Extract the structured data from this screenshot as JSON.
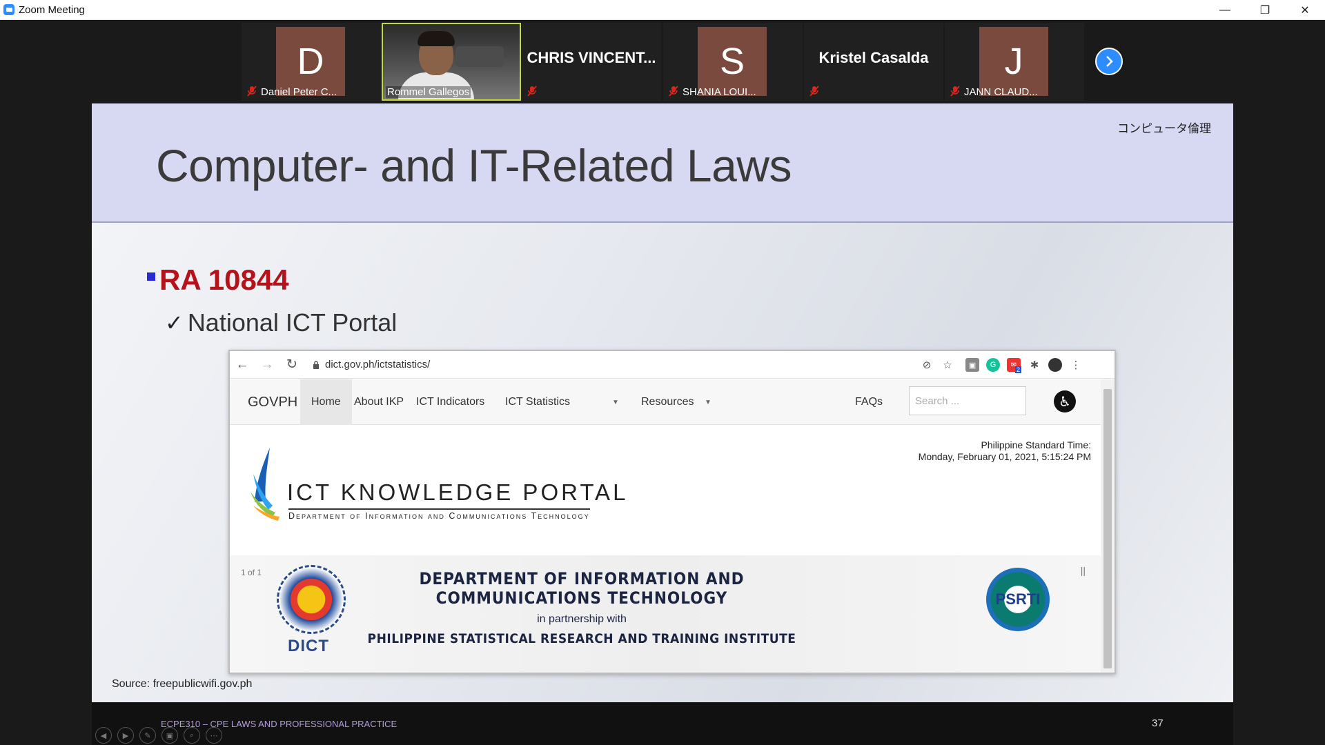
{
  "window": {
    "title": "Zoom Meeting",
    "controls": [
      "—",
      "❐",
      "✕"
    ]
  },
  "participants": [
    {
      "initial": "D",
      "name": "Daniel Peter C...",
      "avatar_color": "#7a4a3e",
      "muted": true
    },
    {
      "initial": "",
      "name": "Rommel Gallegos",
      "video": true
    },
    {
      "initial": "",
      "name": "",
      "big_name": "CHRIS  VINCENT...",
      "muted": true
    },
    {
      "initial": "S",
      "name": "SHANIA LOUI...",
      "avatar_color": "#7a4a3e",
      "muted": true
    },
    {
      "initial": "",
      "name": "",
      "big_name": "Kristel Casalda",
      "muted": true
    },
    {
      "initial": "J",
      "name": "JANN CLAUD...",
      "avatar_color": "#7a4a3e",
      "muted": true
    }
  ],
  "slide": {
    "jp_label": "コンピュータ倫理",
    "heading": "Computer- and IT-Related Laws",
    "bullet1": "RA 10844",
    "bullet2": "National ICT Portal",
    "source": "Source: freepublicwifi.gov.ph",
    "browser": {
      "url": "dict.gov.ph/ictstatistics/",
      "badge_count": "2",
      "nav": {
        "brand": "GOVPH",
        "items": [
          "Home",
          "About IKP",
          "ICT Indicators",
          "ICT Statistics",
          "Resources"
        ],
        "faqs": "FAQs",
        "search_placeholder": "Search ..."
      },
      "time_label": "Philippine Standard Time:",
      "time_value": "Monday, February 01, 2021, 5:15:24 PM",
      "logo_title": "ICT KNOWLEDGE PORTAL",
      "logo_sub": "Department of Information and Communications Technology",
      "banner": {
        "counter": "1 of 1",
        "pause": "||",
        "line1": "DEPARTMENT OF INFORMATION AND COMMUNICATIONS TECHNOLOGY",
        "line2": "in partnership with",
        "line3": "PHILIPPINE STATISTICAL RESEARCH AND TRAINING INSTITUTE",
        "left_logo": "DICT",
        "right_logo": "PSRTI"
      }
    }
  },
  "footer": {
    "course": "ECPE310 – CPE LAWS AND PROFESSIONAL PRACTICE",
    "page": "37"
  }
}
